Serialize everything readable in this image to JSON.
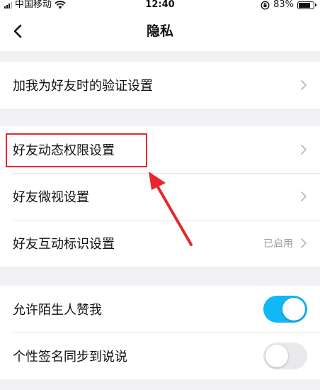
{
  "status_bar": {
    "carrier": "中国移动",
    "time": "12:40",
    "battery": "83%",
    "battery_level": 0.83
  },
  "nav": {
    "title": "隐私"
  },
  "sections": {
    "verification": {
      "label": "加我为好友时的验证设置"
    },
    "friends": [
      {
        "label": "好友动态权限设置",
        "value": ""
      },
      {
        "label": "好友微视设置",
        "value": ""
      },
      {
        "label": "好友互动标识设置",
        "value": "已启用"
      }
    ],
    "toggles": [
      {
        "label": "允许陌生人赞我",
        "on": true
      },
      {
        "label": "个性签名同步到说说",
        "on": false
      }
    ]
  },
  "colors": {
    "accent": "#12b7f5",
    "annotation": "#e8262b",
    "background": "#f1f1f4"
  }
}
